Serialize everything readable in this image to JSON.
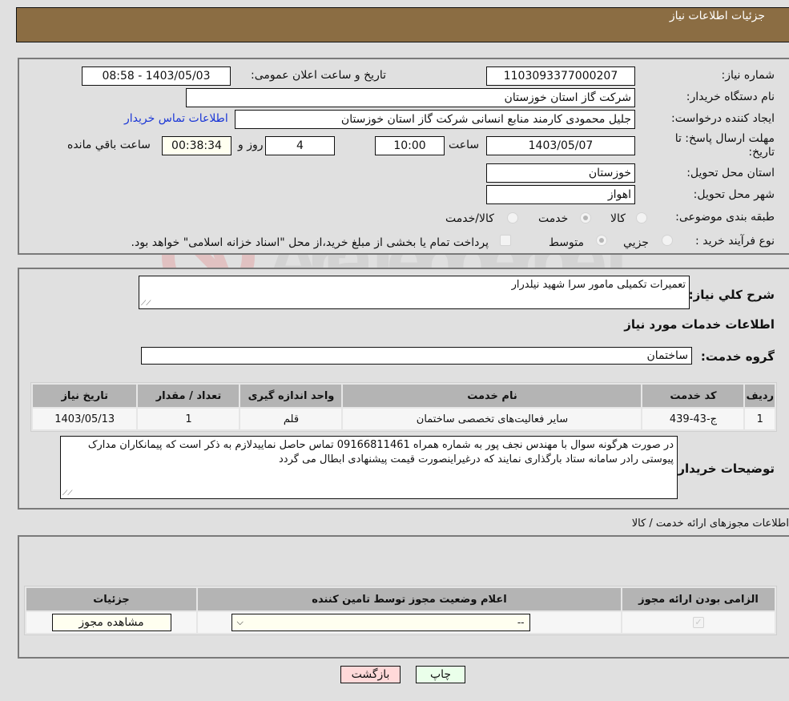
{
  "header": {
    "title": "جزئیات اطلاعات نیاز"
  },
  "form": {
    "need_number": {
      "label": "شماره نیاز:",
      "value": "1103093377000207"
    },
    "announce_datetime": {
      "label": "تاریخ و ساعت اعلان عمومی:",
      "value": "1403/05/03 - 08:58"
    },
    "buyer_org": {
      "label": "نام دستگاه خریدار:",
      "value": "شرکت گاز استان خوزستان"
    },
    "requester": {
      "label": "ایجاد کننده درخواست:",
      "value": "جلیل محمودی کارمند منابع انسانی شرکت گاز استان خوزستان"
    },
    "buyer_contact_link": "اطلاعات تماس خریدار",
    "deadline": {
      "label": "مهلت ارسال پاسخ: تا تاریخ:",
      "date": "1403/05/07",
      "time_label": "ساعت",
      "time": "10:00",
      "days": "4",
      "days_label": "روز و",
      "remaining": "00:38:34",
      "remaining_label": "ساعت باقي مانده"
    },
    "province": {
      "label": "استان محل تحویل:",
      "value": "خوزستان"
    },
    "city": {
      "label": "شهر محل تحویل:",
      "value": "اهواز"
    },
    "category": {
      "label": "طبقه بندی موضوعی:",
      "options": [
        {
          "label": "کالا",
          "selected": false
        },
        {
          "label": "خدمت",
          "selected": true
        },
        {
          "label": "کالا/خدمت",
          "selected": false
        }
      ]
    },
    "purchase_type": {
      "label": "نوع فرآیند خرید :",
      "options": [
        {
          "label": "جزيي",
          "selected": false
        },
        {
          "label": "متوسط",
          "selected": true
        }
      ],
      "treasury_note": "پرداخت تمام یا بخشی از مبلغ خرید،از محل \"اسناد خزانه اسلامی\" خواهد بود.",
      "treasury_checked": false
    }
  },
  "description": {
    "label": "شرح کلي نياز:",
    "value": "تعمیرات تکمیلی مامور سرا شهید نیلدرار"
  },
  "services": {
    "section_title": "اطلاعات خدمات مورد نیاز",
    "group_label": "گروه خدمت:",
    "group_value": "ساختمان",
    "table": {
      "headers": [
        "ردیف",
        "کد خدمت",
        "نام خدمت",
        "واحد اندازه گیری",
        "تعداد / مقدار",
        "تاریخ نیاز"
      ],
      "rows": [
        [
          "1",
          "ج-43-439",
          "سایر فعالیت‌های تخصصی ساختمان",
          "قلم",
          "1",
          "1403/05/13"
        ]
      ]
    }
  },
  "buyer_notes": {
    "label": "توضیحات خریدار:",
    "value": "در صورت هرگونه سوال با مهندس نجف پور به شماره همراه 09166811461 تماس حاصل نماییدلازم به ذکر است که پیمانکاران مدارک پیوستی رادر سامانه ستاد بارگذاری نمایند که درغیراینصورت قیمت پیشنهادی ابطال می گردد"
  },
  "permits": {
    "section_title": "اطلاعات مجوزهای ارائه خدمت / کالا",
    "headers": [
      "الزامی بودن ارائه مجوز",
      "اعلام وضعیت مجوز توسط تامین کننده",
      "جزئیات"
    ],
    "row": {
      "required_checked": true,
      "status_value": "--",
      "details_button": "مشاهده مجوز"
    }
  },
  "actions": {
    "print": "چاپ",
    "back": "بازگشت"
  },
  "watermark": {
    "text": "AriaTender.net"
  },
  "colors": {
    "header_bg": "#8b6d43",
    "back_btn": "#ffd9d9",
    "print_btn": "#eaffea",
    "link": "#1a36d6"
  }
}
